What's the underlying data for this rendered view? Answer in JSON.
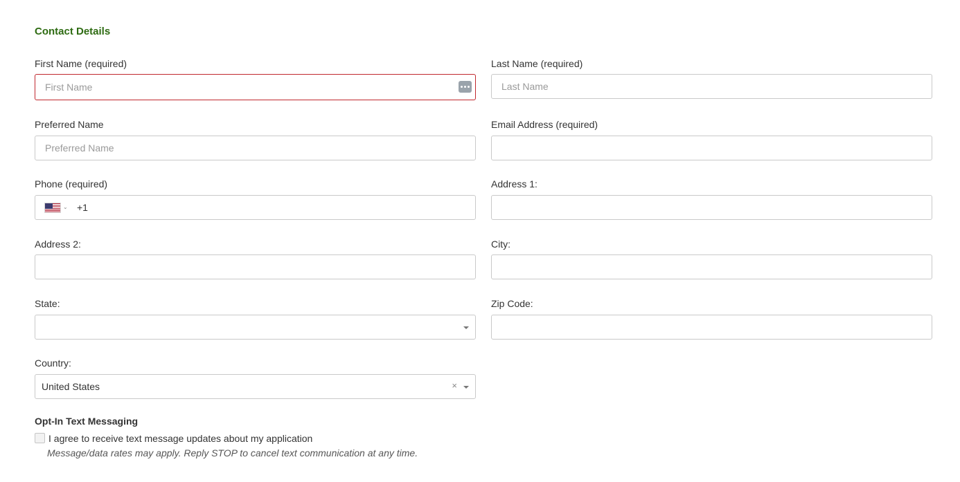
{
  "section_title": "Contact Details",
  "fields": {
    "first_name": {
      "label": "First Name (required)",
      "placeholder": "First Name",
      "value": ""
    },
    "last_name": {
      "label": "Last Name (required)",
      "placeholder": "Last Name",
      "value": ""
    },
    "preferred_name": {
      "label": "Preferred Name",
      "placeholder": "Preferred Name",
      "value": ""
    },
    "email": {
      "label": "Email Address (required)",
      "placeholder": "",
      "value": ""
    },
    "phone": {
      "label": "Phone (required)",
      "dial_code": "+1",
      "country_flag": "us-flag-icon",
      "value": ""
    },
    "address1": {
      "label": "Address 1:",
      "placeholder": "",
      "value": ""
    },
    "address2": {
      "label": "Address 2:",
      "placeholder": "",
      "value": ""
    },
    "city": {
      "label": "City:",
      "placeholder": "",
      "value": ""
    },
    "state": {
      "label": "State:",
      "selected": ""
    },
    "zip": {
      "label": "Zip Code:",
      "placeholder": "",
      "value": ""
    },
    "country": {
      "label": "Country:",
      "selected": "United States"
    }
  },
  "opt_in": {
    "title": "Opt-In Text Messaging",
    "checkbox_label": "I agree to receive text message updates about my application",
    "checked": false,
    "note": "Message/data rates may apply. Reply STOP to cancel text communication at any time."
  },
  "colors": {
    "section_title": "#2e6b12",
    "error_border": "#c0272d",
    "field_border": "#c9c9c9"
  }
}
